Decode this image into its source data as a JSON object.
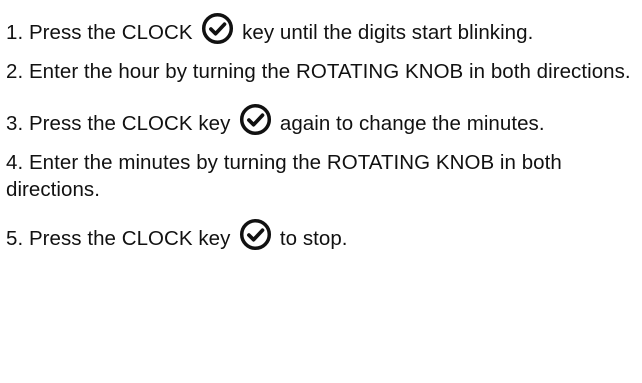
{
  "steps": [
    {
      "before": "1. Press the CLOCK ",
      "icon": "clock-check-icon",
      "after": " key until the digits start blinking."
    },
    {
      "before": "2. Enter the hour by turning the ROTATING KNOB in both directions.",
      "icon": null,
      "after": ""
    },
    {
      "before": "3. Press the CLOCK key ",
      "icon": "clock-check-icon",
      "after": " again to change the minutes."
    },
    {
      "before": "4. Enter the minutes by turning the ROTATING KNOB in both directions.",
      "icon": null,
      "after": ""
    },
    {
      "before": "5. Press the CLOCK key ",
      "icon": "clock-check-icon",
      "after": " to stop."
    }
  ]
}
